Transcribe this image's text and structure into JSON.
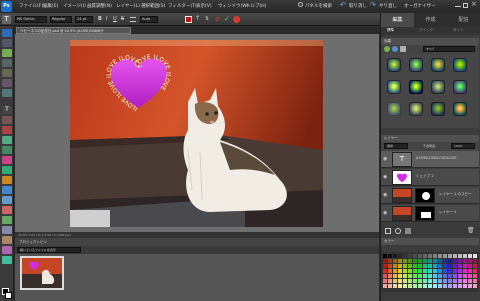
{
  "app": {
    "logo_glyph": "Ps"
  },
  "menu": [
    "ファイル(F)",
    "編集(E)",
    "イメージ(I)",
    "画質調整(N)",
    "レイヤー(L)",
    "選択範囲(S)",
    "フィルター(T)",
    "表示(V)",
    "ウィンドウ(W)",
    "ヘルプ(H)"
  ],
  "title_bar": {
    "search_label": "パネルを検索",
    "undo": "取り消し",
    "redo": "やり直し",
    "organizer": "オーガナイザー"
  },
  "options": {
    "font_family": "MS Gothic",
    "font_style": "Regular",
    "font_size": "24 pt",
    "leading": "Auto",
    "color": "#c41515"
  },
  "document": {
    "tab": "ベビーネコの記念日.psd @ 42.9% (ILOVE,RGB/8)*",
    "zoom": "42.9%",
    "status": "42.9%   7.61 cm x 5.59 cm (300 ppi)"
  },
  "project_bin": {
    "title": "プロジェクトビン",
    "filter": "開いているファイルを表示"
  },
  "mode_tabs": [
    "編集",
    "作成",
    "配信"
  ],
  "sub_tabs": [
    "標準",
    "クイック",
    "ガイド"
  ],
  "effects": {
    "header": "効果",
    "filter_label": "エフェクト",
    "dropdown": "すべて"
  },
  "layers": {
    "header": "レイヤー",
    "blend": "通常",
    "opacity_label": "不透明度:",
    "opacity": "100%",
    "rows": [
      {
        "name": "ILOVEILOVEILOVEILOVE"
      },
      {
        "name": "シェイプ 1"
      },
      {
        "name": "レイヤー 1 のコピー"
      },
      {
        "name": "レイヤー 1"
      }
    ]
  },
  "palette_title": "カラー",
  "heart_text": "ILOVE ILOVE ILOVE ILOVE ILOVE ILOVE ILOVE",
  "colors": {
    "accent": "#c41515",
    "heart": "#d22be0"
  }
}
